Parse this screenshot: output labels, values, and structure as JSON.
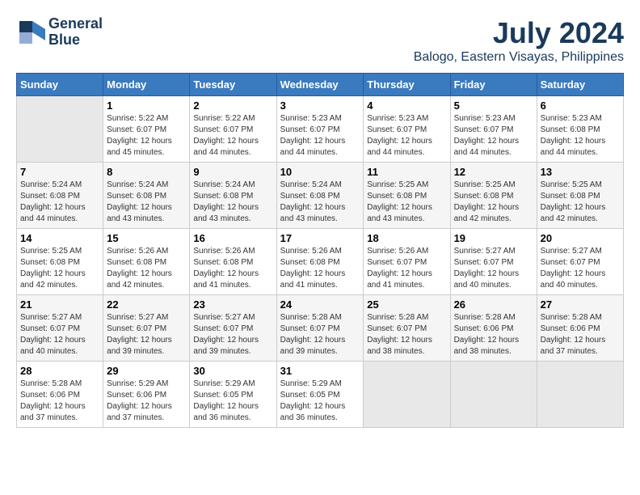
{
  "header": {
    "logo_line1": "General",
    "logo_line2": "Blue",
    "month_year": "July 2024",
    "location": "Balogo, Eastern Visayas, Philippines"
  },
  "calendar": {
    "weekdays": [
      "Sunday",
      "Monday",
      "Tuesday",
      "Wednesday",
      "Thursday",
      "Friday",
      "Saturday"
    ],
    "weeks": [
      [
        {
          "day": "",
          "info": ""
        },
        {
          "day": "1",
          "info": "Sunrise: 5:22 AM\nSunset: 6:07 PM\nDaylight: 12 hours\nand 45 minutes."
        },
        {
          "day": "2",
          "info": "Sunrise: 5:22 AM\nSunset: 6:07 PM\nDaylight: 12 hours\nand 44 minutes."
        },
        {
          "day": "3",
          "info": "Sunrise: 5:23 AM\nSunset: 6:07 PM\nDaylight: 12 hours\nand 44 minutes."
        },
        {
          "day": "4",
          "info": "Sunrise: 5:23 AM\nSunset: 6:07 PM\nDaylight: 12 hours\nand 44 minutes."
        },
        {
          "day": "5",
          "info": "Sunrise: 5:23 AM\nSunset: 6:07 PM\nDaylight: 12 hours\nand 44 minutes."
        },
        {
          "day": "6",
          "info": "Sunrise: 5:23 AM\nSunset: 6:08 PM\nDaylight: 12 hours\nand 44 minutes."
        }
      ],
      [
        {
          "day": "7",
          "info": "Sunrise: 5:24 AM\nSunset: 6:08 PM\nDaylight: 12 hours\nand 44 minutes."
        },
        {
          "day": "8",
          "info": "Sunrise: 5:24 AM\nSunset: 6:08 PM\nDaylight: 12 hours\nand 43 minutes."
        },
        {
          "day": "9",
          "info": "Sunrise: 5:24 AM\nSunset: 6:08 PM\nDaylight: 12 hours\nand 43 minutes."
        },
        {
          "day": "10",
          "info": "Sunrise: 5:24 AM\nSunset: 6:08 PM\nDaylight: 12 hours\nand 43 minutes."
        },
        {
          "day": "11",
          "info": "Sunrise: 5:25 AM\nSunset: 6:08 PM\nDaylight: 12 hours\nand 43 minutes."
        },
        {
          "day": "12",
          "info": "Sunrise: 5:25 AM\nSunset: 6:08 PM\nDaylight: 12 hours\nand 42 minutes."
        },
        {
          "day": "13",
          "info": "Sunrise: 5:25 AM\nSunset: 6:08 PM\nDaylight: 12 hours\nand 42 minutes."
        }
      ],
      [
        {
          "day": "14",
          "info": "Sunrise: 5:25 AM\nSunset: 6:08 PM\nDaylight: 12 hours\nand 42 minutes."
        },
        {
          "day": "15",
          "info": "Sunrise: 5:26 AM\nSunset: 6:08 PM\nDaylight: 12 hours\nand 42 minutes."
        },
        {
          "day": "16",
          "info": "Sunrise: 5:26 AM\nSunset: 6:08 PM\nDaylight: 12 hours\nand 41 minutes."
        },
        {
          "day": "17",
          "info": "Sunrise: 5:26 AM\nSunset: 6:08 PM\nDaylight: 12 hours\nand 41 minutes."
        },
        {
          "day": "18",
          "info": "Sunrise: 5:26 AM\nSunset: 6:07 PM\nDaylight: 12 hours\nand 41 minutes."
        },
        {
          "day": "19",
          "info": "Sunrise: 5:27 AM\nSunset: 6:07 PM\nDaylight: 12 hours\nand 40 minutes."
        },
        {
          "day": "20",
          "info": "Sunrise: 5:27 AM\nSunset: 6:07 PM\nDaylight: 12 hours\nand 40 minutes."
        }
      ],
      [
        {
          "day": "21",
          "info": "Sunrise: 5:27 AM\nSunset: 6:07 PM\nDaylight: 12 hours\nand 40 minutes."
        },
        {
          "day": "22",
          "info": "Sunrise: 5:27 AM\nSunset: 6:07 PM\nDaylight: 12 hours\nand 39 minutes."
        },
        {
          "day": "23",
          "info": "Sunrise: 5:27 AM\nSunset: 6:07 PM\nDaylight: 12 hours\nand 39 minutes."
        },
        {
          "day": "24",
          "info": "Sunrise: 5:28 AM\nSunset: 6:07 PM\nDaylight: 12 hours\nand 39 minutes."
        },
        {
          "day": "25",
          "info": "Sunrise: 5:28 AM\nSunset: 6:07 PM\nDaylight: 12 hours\nand 38 minutes."
        },
        {
          "day": "26",
          "info": "Sunrise: 5:28 AM\nSunset: 6:06 PM\nDaylight: 12 hours\nand 38 minutes."
        },
        {
          "day": "27",
          "info": "Sunrise: 5:28 AM\nSunset: 6:06 PM\nDaylight: 12 hours\nand 37 minutes."
        }
      ],
      [
        {
          "day": "28",
          "info": "Sunrise: 5:28 AM\nSunset: 6:06 PM\nDaylight: 12 hours\nand 37 minutes."
        },
        {
          "day": "29",
          "info": "Sunrise: 5:29 AM\nSunset: 6:06 PM\nDaylight: 12 hours\nand 37 minutes."
        },
        {
          "day": "30",
          "info": "Sunrise: 5:29 AM\nSunset: 6:05 PM\nDaylight: 12 hours\nand 36 minutes."
        },
        {
          "day": "31",
          "info": "Sunrise: 5:29 AM\nSunset: 6:05 PM\nDaylight: 12 hours\nand 36 minutes."
        },
        {
          "day": "",
          "info": ""
        },
        {
          "day": "",
          "info": ""
        },
        {
          "day": "",
          "info": ""
        }
      ]
    ]
  }
}
